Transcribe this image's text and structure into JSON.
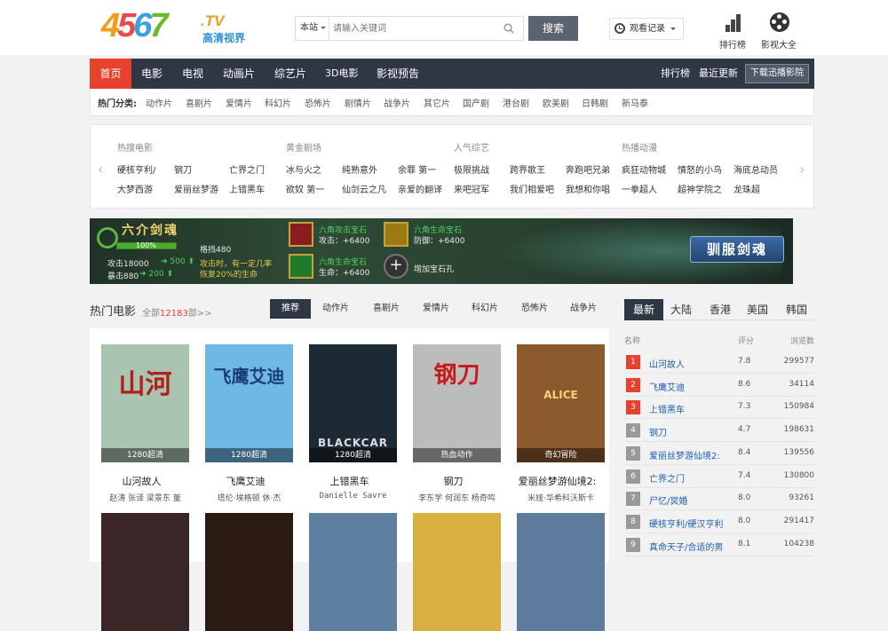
{
  "header": {
    "logo": {
      "d1": "4",
      "d2": "5",
      "d3": "6",
      "d4": "7",
      "tv": ".TV",
      "sub": "高清视界"
    },
    "search": {
      "scope": "本站",
      "placeholder": "请输入关键词",
      "button": "搜索"
    },
    "history": "观看记录",
    "tools": [
      {
        "label": "排行榜",
        "icon": "bar-chart-icon"
      },
      {
        "label": "影视大全",
        "icon": "film-reel-icon"
      }
    ]
  },
  "nav": {
    "items": [
      "首页",
      "电影",
      "电视",
      "动画片",
      "综艺片",
      "3D电影",
      "影视预告"
    ],
    "right": [
      "排行榜",
      "最近更新"
    ],
    "download": "下载迅播影院"
  },
  "hot_categories": {
    "label": "热门分类:",
    "items": [
      "动作片",
      "喜剧片",
      "爱情片",
      "科幻片",
      "恐怖片",
      "剧情片",
      "战争片",
      "其它片",
      "国产剧",
      "港台剧",
      "欧美剧",
      "日韩剧",
      "新马泰"
    ]
  },
  "recommend": {
    "groups": [
      {
        "title": "热搜电影",
        "links": [
          "硬核亨利/",
          "钢刀",
          "亡界之门",
          "大梦西游",
          "爱丽丝梦游",
          "上错黑车"
        ]
      },
      {
        "title": "黄金剧场",
        "links": [
          "冰与火之",
          "纯熟意外",
          "余罪 第一",
          "欲奴 第一",
          "仙剑云之凡",
          "亲爱的翻译"
        ]
      },
      {
        "title": "人气综艺",
        "links": [
          "极限挑战",
          "跨界歌王",
          "奔跑吧兄弟",
          "来吧冠军",
          "我们相爱吧",
          "我想和你唱"
        ]
      },
      {
        "title": "热播动漫",
        "links": [
          "疯狂动物城",
          "憤怒的小鸟",
          "海底总动员",
          "一拳超人",
          "超神学院之",
          "龙珠超"
        ]
      }
    ]
  },
  "banner": {
    "title": "六介剑魂",
    "percent": "100%",
    "stats": [
      "攻击18000",
      "500",
      "暴击880",
      "200"
    ],
    "level": "格挡480",
    "tip1": "攻击时，有一定几率",
    "tip2": "恢复20%的生命",
    "gems": [
      {
        "name": "六角攻击宝石",
        "stat": "攻击：+6400"
      },
      {
        "name": "六角生命宝石",
        "stat": "防御：+6400"
      },
      {
        "name": "六角生命宝石",
        "stat": "生命：+6400"
      }
    ],
    "add": "增加宝石孔",
    "button": "驯服剑魂"
  },
  "movies_section": {
    "title": "热门电影",
    "all_prefix": "全部",
    "all_count": "12183",
    "all_suffix": "部>>",
    "tabs": [
      "推荐",
      "动作片",
      "喜剧片",
      "爱情片",
      "科幻片",
      "恐怖片",
      "战争片"
    ]
  },
  "movies": [
    {
      "name": "山河故人",
      "cast": "赵涛 张译 梁景东 董",
      "tag": "1280超清",
      "poster": "山河",
      "color": "#a9c4b0"
    },
    {
      "name": "飞鹰艾迪",
      "cast": "塔伦·埃格顿 休·杰",
      "tag": "1280超清",
      "poster": "飞鹰艾迪",
      "color": "#6fb7e6"
    },
    {
      "name": "上错黑车",
      "cast": "Danielle Savre",
      "tag": "1280超清",
      "poster": "BLACKCAR",
      "color": "#1c2a35"
    },
    {
      "name": "钢刀",
      "cast": "李东学 何润东 杨奇鸣",
      "tag": "热血动作",
      "poster": "钢刀",
      "color": "#bcbcbc"
    },
    {
      "name": "爱丽丝梦游仙境2:",
      "cast": "米娅·华希科沃斯卡",
      "tag": "奇幻冒险",
      "poster": "ALICE",
      "color": "#8a5a2c"
    }
  ],
  "ranking": {
    "tabs": [
      "最新",
      "大陆",
      "香港",
      "美国",
      "韩国"
    ],
    "headers": [
      "名称",
      "评分",
      "浏览数"
    ],
    "rows": [
      {
        "n": "1",
        "name": "山河故人",
        "score": "7.8",
        "views": "299577"
      },
      {
        "n": "2",
        "name": "飞鹰艾迪",
        "score": "8.6",
        "views": "34114"
      },
      {
        "n": "3",
        "name": "上错黑车",
        "score": "7.3",
        "views": "150984"
      },
      {
        "n": "4",
        "name": "钢刀",
        "score": "4.7",
        "views": "198631"
      },
      {
        "n": "5",
        "name": "爱丽丝梦游仙境2:",
        "score": "8.4",
        "views": "139556"
      },
      {
        "n": "6",
        "name": "亡界之门",
        "score": "7.4",
        "views": "130800"
      },
      {
        "n": "7",
        "name": "尸忆/冥婚",
        "score": "8.0",
        "views": "93261"
      },
      {
        "n": "8",
        "name": "硬核亨利/硬汉亨利",
        "score": "8.0",
        "views": "291417"
      },
      {
        "n": "9",
        "name": "真命天子/合适的男",
        "score": "8.1",
        "views": "104238"
      }
    ]
  },
  "colors": {
    "nav_bg": "#2f3745",
    "accent": "#e8412d",
    "rank_top": "#e8412d",
    "rank_other": "#999999"
  }
}
